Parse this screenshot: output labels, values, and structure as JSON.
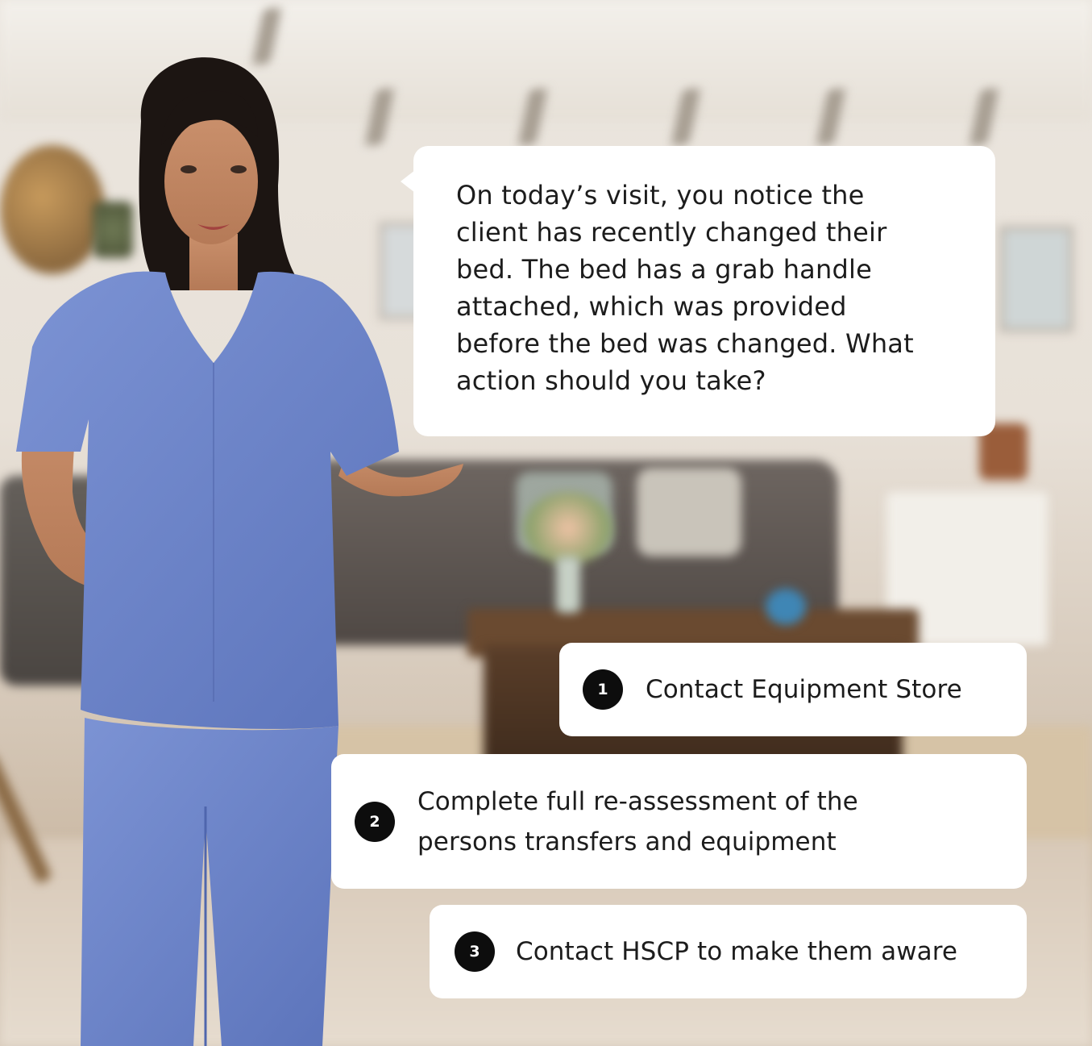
{
  "question": {
    "text": "On today’s visit, you notice the\nclient has recently changed their\nbed. The bed has a grab handle\nattached, which was provided\nbefore the bed was changed.  What\naction should you take?"
  },
  "options": [
    {
      "number": "1",
      "label": "Contact Equipment Store"
    },
    {
      "number": "2",
      "label": "Complete full re-assessment of the\npersons transfers and equipment"
    },
    {
      "number": "3",
      "label": "Contact HSCP to make them aware"
    }
  ],
  "scene": {
    "background": "living-room-photo",
    "character": "nurse-in-blue-scrubs",
    "scrub_color": "#6f86c9"
  }
}
